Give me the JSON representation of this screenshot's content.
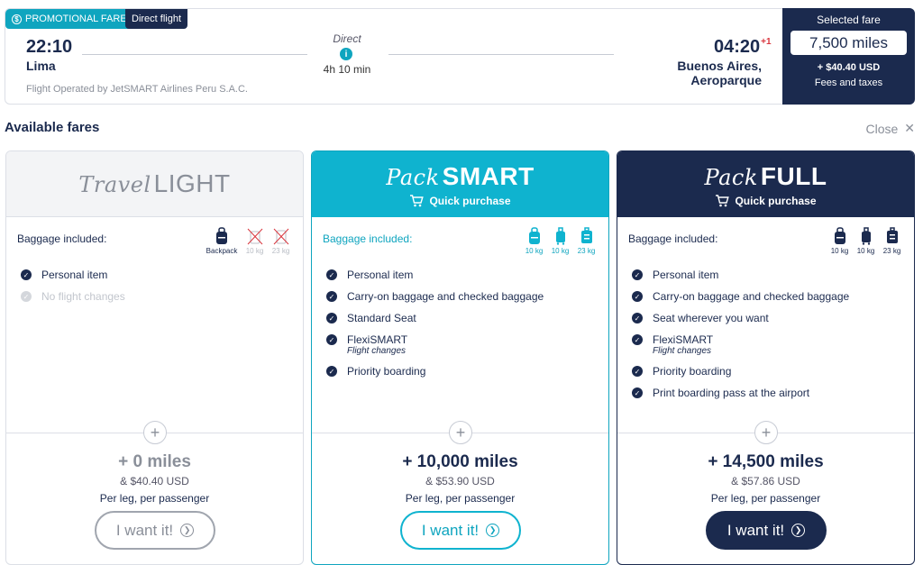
{
  "flight": {
    "promo_tag": "PROMOTIONAL FARE!",
    "direct_tag": "Direct flight",
    "departure_time": "22:10",
    "departure_city": "Lima",
    "route_type": "Direct",
    "duration": "4h 10 min",
    "arrival_time": "04:20",
    "arrival_day_offset": "+1",
    "arrival_city": "Buenos Aires, Aeroparque",
    "operated_by": "Flight Operated by JetSMART Airlines Peru S.A.C."
  },
  "selected": {
    "title": "Selected fare",
    "miles": "7,500 miles",
    "extra": "+ $40.40 USD",
    "fees": "Fees and taxes"
  },
  "section": {
    "title": "Available fares",
    "close": "Close"
  },
  "fares": [
    {
      "brand_script": "Travel",
      "brand_bold": "LIGHT",
      "quick": "",
      "bag_label": "Baggage included:",
      "bags": [
        "Backpack",
        "10 kg",
        "23 kg"
      ],
      "features": [
        {
          "label": "Personal item",
          "sub": ""
        },
        {
          "label": "No flight changes",
          "sub": ""
        }
      ],
      "miles": "+ 0 miles",
      "usd": "& $40.40 USD",
      "per_leg": "Per leg, per passenger",
      "button": "I want it!"
    },
    {
      "brand_script": "Pack",
      "brand_bold": "SMART",
      "quick": "Quick purchase",
      "bag_label": "Baggage included:",
      "bags": [
        "10 kg",
        "10 kg",
        "23 kg"
      ],
      "features": [
        {
          "label": "Personal item",
          "sub": ""
        },
        {
          "label": "Carry-on baggage and checked baggage",
          "sub": ""
        },
        {
          "label": "Standard Seat",
          "sub": ""
        },
        {
          "label": "FlexiSMART",
          "sub": "Flight changes"
        },
        {
          "label": "Priority boarding",
          "sub": ""
        }
      ],
      "miles": "+ 10,000 miles",
      "usd": "& $53.90 USD",
      "per_leg": "Per leg, per passenger",
      "button": "I want it!"
    },
    {
      "brand_script": "Pack",
      "brand_bold": "FULL",
      "quick": "Quick purchase",
      "bag_label": "Baggage included:",
      "bags": [
        "10 kg",
        "10 kg",
        "23 kg"
      ],
      "features": [
        {
          "label": "Personal item",
          "sub": ""
        },
        {
          "label": "Carry-on baggage and checked baggage",
          "sub": ""
        },
        {
          "label": "Seat wherever you want",
          "sub": ""
        },
        {
          "label": "FlexiSMART",
          "sub": "Flight changes"
        },
        {
          "label": "Priority boarding",
          "sub": ""
        },
        {
          "label": "Print boarding pass at the airport",
          "sub": ""
        }
      ],
      "miles": "+ 14,500 miles",
      "usd": "& $57.86 USD",
      "per_leg": "Per leg, per passenger",
      "button": "I want it!"
    }
  ],
  "colors": {
    "navy": "#1b2a4e",
    "teal": "#0fb3cf",
    "accent_red": "#d9363e"
  }
}
